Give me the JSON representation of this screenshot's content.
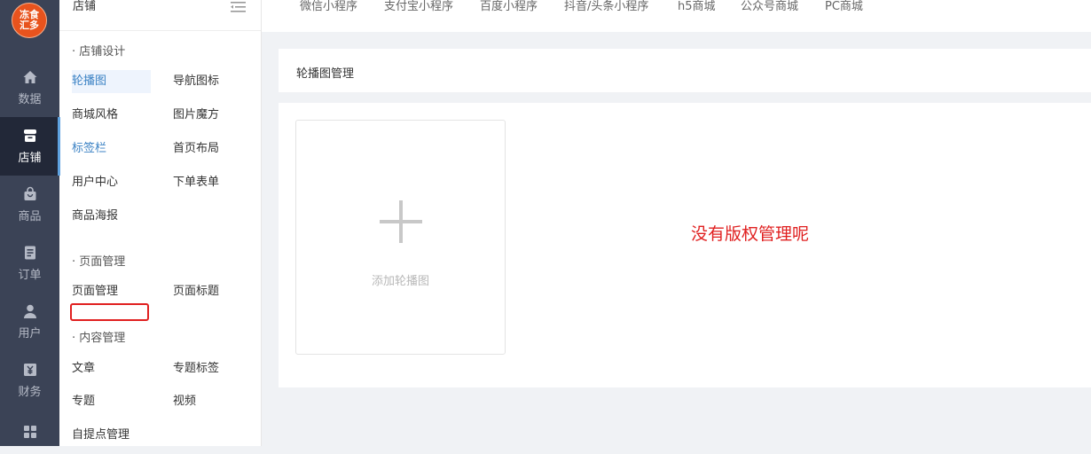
{
  "brand": {
    "logo_line1": "冻食",
    "logo_line2": "汇多"
  },
  "rail": {
    "items": [
      {
        "label": "数据",
        "icon": "home-icon"
      },
      {
        "label": "店铺",
        "icon": "store-icon",
        "active": true
      },
      {
        "label": "商品",
        "icon": "bag-icon"
      },
      {
        "label": "订单",
        "icon": "order-icon"
      },
      {
        "label": "用户",
        "icon": "user-icon"
      },
      {
        "label": "财务",
        "icon": "finance-icon"
      },
      {
        "label": "",
        "icon": "apps-icon"
      }
    ]
  },
  "submenu": {
    "title": "店铺",
    "groups": [
      {
        "title": "· 店铺设计",
        "items": [
          "轮播图",
          "导航图标",
          "商城风格",
          "图片魔方",
          "标签栏",
          "首页布局",
          "用户中心",
          "下单表单",
          "商品海报"
        ]
      },
      {
        "title": "· 页面管理",
        "items": [
          "页面管理",
          "页面标题"
        ]
      },
      {
        "title": "· 内容管理",
        "items": [
          "文章",
          "专题标签",
          "专题",
          "视频",
          "自提点管理"
        ]
      }
    ]
  },
  "tabs": [
    "微信小程序",
    "支付宝小程序",
    "百度小程序",
    "抖音/头条小程序",
    "h5商城",
    "公众号商城",
    "PC商城"
  ],
  "panel": {
    "title": "轮播图管理",
    "upload_label": "添加轮播图",
    "no_permission": "没有版权管理呢"
  },
  "colors": {
    "accent": "#3b82c4",
    "rail": "#3b4356",
    "rail_active": "#222838",
    "warning": "#e02020",
    "logo": "#e8531d"
  }
}
